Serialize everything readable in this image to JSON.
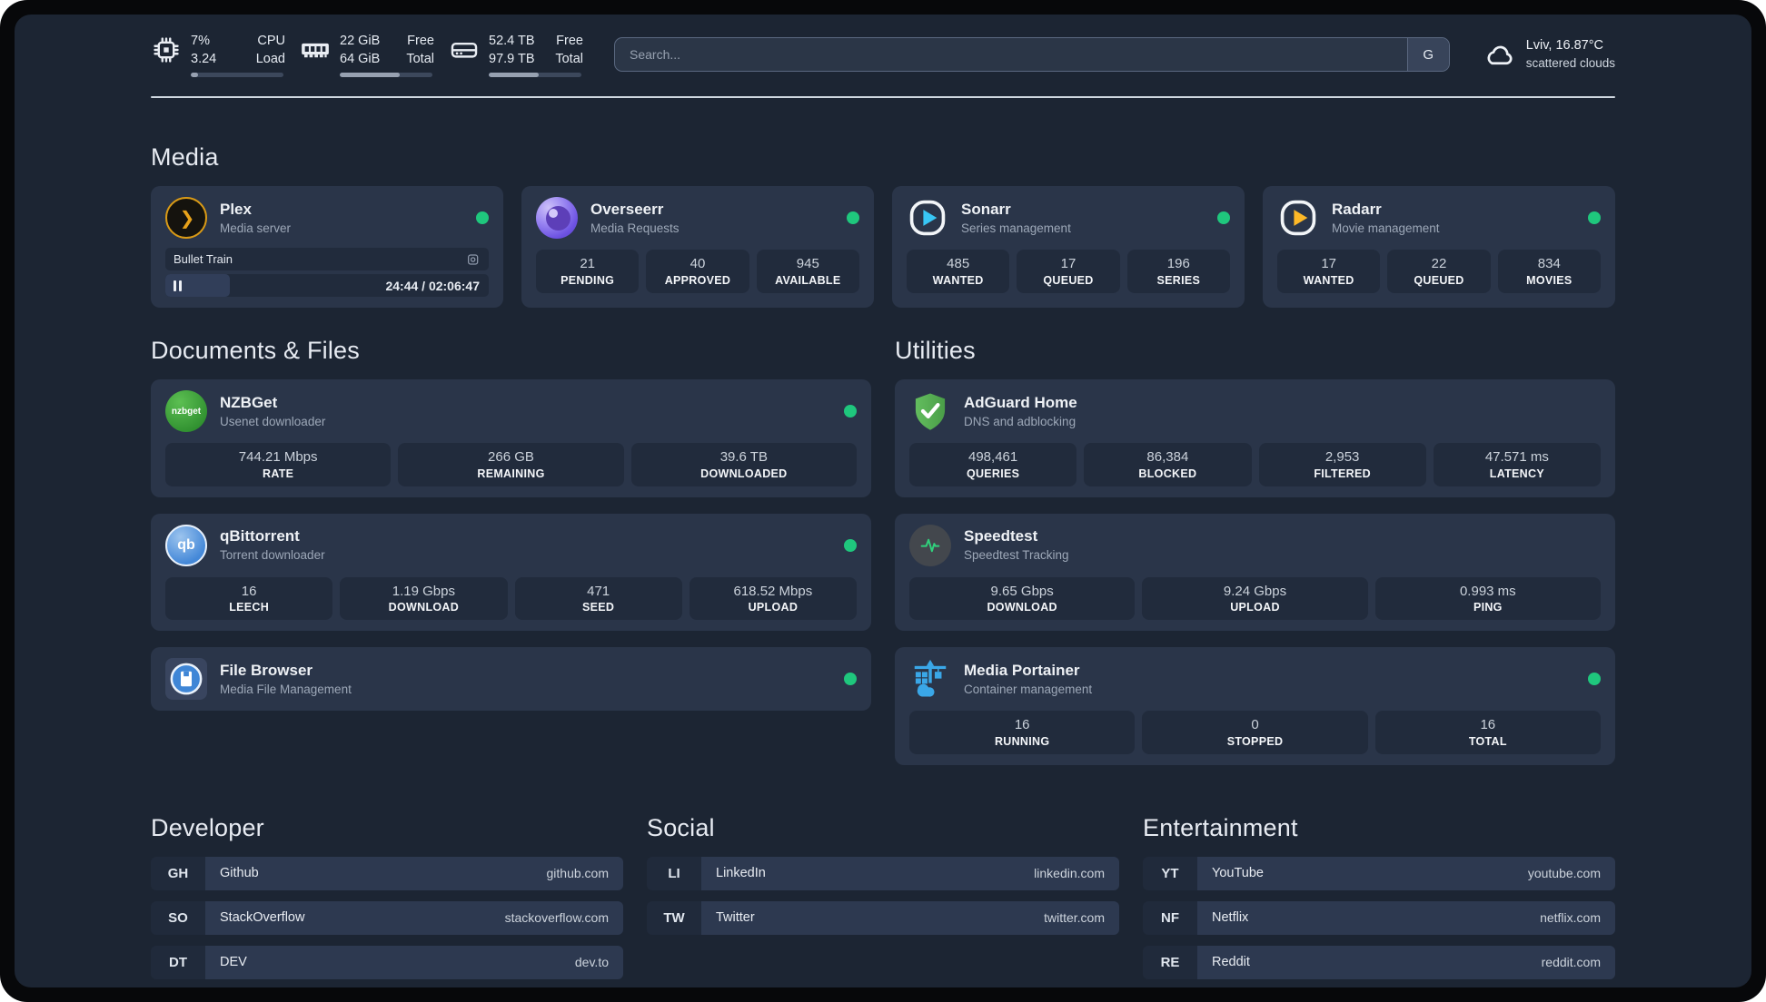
{
  "colors": {
    "status_green": "#1fc77d",
    "plex_orange": "#e8a21a",
    "sonarr_blue": "#38c6f4",
    "radarr_yellow": "#fdb827",
    "adguard_green_light": "#63bd5e",
    "adguard_green_dark": "#4a9e48",
    "qbittorrent_blue": "#4488d8",
    "nzbget_green": "#2f8f2f",
    "portainer_blue": "#3aa7e8",
    "speedtest_green": "#31d07c"
  },
  "topbar": {
    "cpu": {
      "values": [
        "7%",
        "3.24"
      ],
      "labels": [
        "CPU",
        "Load"
      ],
      "progress": 8
    },
    "memory": {
      "values": [
        "22 GiB",
        "64 GiB"
      ],
      "labels": [
        "Free",
        "Total"
      ],
      "progress": 65
    },
    "disk": {
      "values": [
        "52.4 TB",
        "97.9 TB"
      ],
      "labels": [
        "Free",
        "Total"
      ],
      "progress": 54
    },
    "search": {
      "placeholder": "Search...",
      "provider": "G"
    },
    "weather": {
      "location": "Lviv, 16.87°C",
      "condition": "scattered clouds"
    }
  },
  "media": {
    "header": "Media",
    "plex": {
      "title": "Plex",
      "subtitle": "Media server",
      "now_playing": "Bullet Train",
      "time": "24:44 / 02:06:47",
      "progress": 20
    },
    "overseerr": {
      "title": "Overseerr",
      "subtitle": "Media Requests",
      "stats": [
        {
          "value": "21",
          "label": "PENDING"
        },
        {
          "value": "40",
          "label": "APPROVED"
        },
        {
          "value": "945",
          "label": "AVAILABLE"
        }
      ]
    },
    "sonarr": {
      "title": "Sonarr",
      "subtitle": "Series management",
      "stats": [
        {
          "value": "485",
          "label": "WANTED"
        },
        {
          "value": "17",
          "label": "QUEUED"
        },
        {
          "value": "196",
          "label": "SERIES"
        }
      ]
    },
    "radarr": {
      "title": "Radarr",
      "subtitle": "Movie management",
      "stats": [
        {
          "value": "17",
          "label": "WANTED"
        },
        {
          "value": "22",
          "label": "QUEUED"
        },
        {
          "value": "834",
          "label": "MOVIES"
        }
      ]
    }
  },
  "documents": {
    "header": "Documents & Files",
    "nzbget": {
      "title": "NZBGet",
      "subtitle": "Usenet downloader",
      "icon_text": "nzbget",
      "stats": [
        {
          "value": "744.21 Mbps",
          "label": "RATE"
        },
        {
          "value": "266 GB",
          "label": "REMAINING"
        },
        {
          "value": "39.6 TB",
          "label": "DOWNLOADED"
        }
      ]
    },
    "qbittorrent": {
      "title": "qBittorrent",
      "subtitle": "Torrent downloader",
      "icon_text": "qb",
      "stats": [
        {
          "value": "16",
          "label": "LEECH"
        },
        {
          "value": "1.19 Gbps",
          "label": "DOWNLOAD"
        },
        {
          "value": "471",
          "label": "SEED"
        },
        {
          "value": "618.52 Mbps",
          "label": "UPLOAD"
        }
      ]
    },
    "filebrowser": {
      "title": "File Browser",
      "subtitle": "Media File Management"
    }
  },
  "utilities": {
    "header": "Utilities",
    "adguard": {
      "title": "AdGuard Home",
      "subtitle": "DNS and adblocking",
      "stats": [
        {
          "value": "498,461",
          "label": "QUERIES"
        },
        {
          "value": "86,384",
          "label": "BLOCKED"
        },
        {
          "value": "2,953",
          "label": "FILTERED"
        },
        {
          "value": "47.571 ms",
          "label": "LATENCY"
        }
      ]
    },
    "speedtest": {
      "title": "Speedtest",
      "subtitle": "Speedtest Tracking",
      "stats": [
        {
          "value": "9.65 Gbps",
          "label": "DOWNLOAD"
        },
        {
          "value": "9.24 Gbps",
          "label": "UPLOAD"
        },
        {
          "value": "0.993 ms",
          "label": "PING"
        }
      ]
    },
    "portainer": {
      "title": "Media Portainer",
      "subtitle": "Container management",
      "stats": [
        {
          "value": "16",
          "label": "RUNNING"
        },
        {
          "value": "0",
          "label": "STOPPED"
        },
        {
          "value": "16",
          "label": "TOTAL"
        }
      ]
    }
  },
  "bookmarks": {
    "developer": {
      "header": "Developer",
      "items": [
        {
          "abbr": "GH",
          "name": "Github",
          "url": "github.com"
        },
        {
          "abbr": "SO",
          "name": "StackOverflow",
          "url": "stackoverflow.com"
        },
        {
          "abbr": "DT",
          "name": "DEV",
          "url": "dev.to"
        }
      ]
    },
    "social": {
      "header": "Social",
      "items": [
        {
          "abbr": "LI",
          "name": "LinkedIn",
          "url": "linkedin.com"
        },
        {
          "abbr": "TW",
          "name": "Twitter",
          "url": "twitter.com"
        }
      ]
    },
    "entertainment": {
      "header": "Entertainment",
      "items": [
        {
          "abbr": "YT",
          "name": "YouTube",
          "url": "youtube.com"
        },
        {
          "abbr": "NF",
          "name": "Netflix",
          "url": "netflix.com"
        },
        {
          "abbr": "RE",
          "name": "Reddit",
          "url": "reddit.com"
        }
      ]
    }
  }
}
